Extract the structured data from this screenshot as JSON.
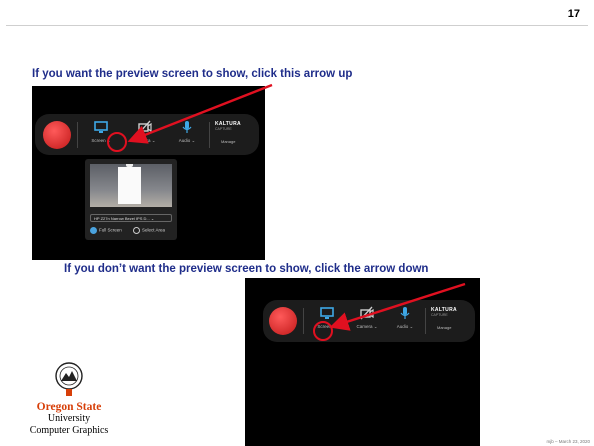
{
  "slide": {
    "page_number": "17",
    "instruction_up": "If you want the preview screen to show, click this arrow up",
    "instruction_down": "If you don’t want the preview screen to show, click the arrow down",
    "footer_note": "mjb – March 23, 2020"
  },
  "toolbar_top": {
    "screen_label": "Screen ⌄",
    "camera_label": "Camera ⌄",
    "audio_label": "Audio ⌄",
    "brand": "KALTURA",
    "brand_sub": "CAPTURE",
    "manage_label": "Manage"
  },
  "preview": {
    "monitor_select": "HP Z27n Narrow Bezel IPS D... ⌄",
    "option_full": "Full Screen",
    "option_area": "Select Area"
  },
  "toolbar_bottom": {
    "screen_label": "Screen ⌄",
    "camera_label": "Camera ⌄",
    "audio_label": "Audio ⌄",
    "brand": "KALTURA",
    "brand_sub": "CAPTURE",
    "manage_label": "Manage"
  },
  "logo": {
    "name": "Oregon State",
    "university": "University",
    "department": "Computer Graphics"
  },
  "colors": {
    "instruction_text": "#1f2d8a",
    "arrow": "#e01020",
    "osu_orange": "#d73f09"
  }
}
